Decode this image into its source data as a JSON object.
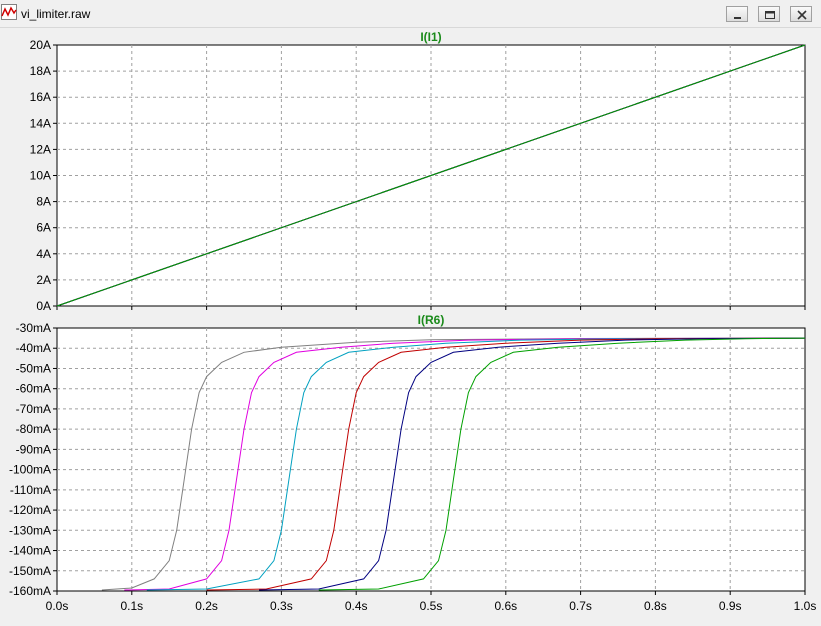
{
  "window": {
    "title": "vi_limiter.raw",
    "icon": "waveform-icon",
    "buttons": [
      "minimize-icon",
      "restore-icon",
      "close-icon"
    ]
  },
  "colors": {
    "grid": "#a0a0a0",
    "trace_names": "#1a8a1a",
    "series": [
      "#808080",
      "#e000e0",
      "#00a0c0",
      "#c00000",
      "#000080",
      "#00a000"
    ]
  },
  "chart_data": [
    {
      "type": "line",
      "title": "I(I1)",
      "xlabel": "",
      "ylabel": "",
      "xlim": [
        0,
        1.0
      ],
      "ylim": [
        0,
        20
      ],
      "x_ticks": [
        "0.0s",
        "0.1s",
        "0.2s",
        "0.3s",
        "0.4s",
        "0.5s",
        "0.6s",
        "0.7s",
        "0.8s",
        "0.9s",
        "1.0s"
      ],
      "y_ticks": [
        "0A",
        "2A",
        "4A",
        "6A",
        "8A",
        "10A",
        "12A",
        "14A",
        "16A",
        "18A",
        "20A"
      ],
      "grid": true,
      "series": [
        {
          "color": "#808080",
          "x": [
            0,
            1.0
          ],
          "y": [
            0,
            20
          ]
        },
        {
          "color": "#e000e0",
          "x": [
            0,
            1.0
          ],
          "y": [
            0,
            20
          ]
        },
        {
          "color": "#00a0c0",
          "x": [
            0,
            1.0
          ],
          "y": [
            0,
            20
          ]
        },
        {
          "color": "#c00000",
          "x": [
            0,
            1.0
          ],
          "y": [
            0,
            20
          ]
        },
        {
          "color": "#000080",
          "x": [
            0,
            1.0
          ],
          "y": [
            0,
            20
          ]
        },
        {
          "color": "#00a000",
          "x": [
            0,
            1.0
          ],
          "y": [
            0,
            20
          ]
        }
      ]
    },
    {
      "type": "line",
      "title": "I(R6)",
      "xlabel": "",
      "ylabel": "",
      "xlim": [
        0,
        1.0
      ],
      "ylim": [
        -160,
        -30
      ],
      "x_ticks": [
        "0.0s",
        "0.1s",
        "0.2s",
        "0.3s",
        "0.4s",
        "0.5s",
        "0.6s",
        "0.7s",
        "0.8s",
        "0.9s",
        "1.0s"
      ],
      "y_ticks": [
        "-30mA",
        "-40mA",
        "-50mA",
        "-60mA",
        "-70mA",
        "-80mA",
        "-90mA",
        "-100mA",
        "-110mA",
        "-120mA",
        "-130mA",
        "-140mA",
        "-150mA",
        "-160mA"
      ],
      "grid": true,
      "series": [
        {
          "color": "#808080",
          "x": [
            0.06,
            0.1,
            0.13,
            0.15,
            0.16,
            0.17,
            0.18,
            0.19,
            0.2,
            0.22,
            0.25,
            0.3,
            0.4,
            0.5,
            0.7,
            1.0
          ],
          "y": [
            -159.5,
            -158.5,
            -154,
            -145,
            -130,
            -105,
            -80,
            -62,
            -54,
            -47,
            -42,
            -39.5,
            -37,
            -35.8,
            -35.2,
            -35
          ]
        },
        {
          "color": "#e000e0",
          "x": [
            0.09,
            0.15,
            0.2,
            0.22,
            0.23,
            0.24,
            0.25,
            0.26,
            0.27,
            0.29,
            0.32,
            0.38,
            0.45,
            0.55,
            0.7,
            1.0
          ],
          "y": [
            -159.5,
            -159,
            -154,
            -145,
            -130,
            -105,
            -80,
            -62,
            -54,
            -47,
            -42,
            -39.5,
            -37.5,
            -36,
            -35.3,
            -35
          ]
        },
        {
          "color": "#00a0c0",
          "x": [
            0.12,
            0.2,
            0.27,
            0.29,
            0.3,
            0.31,
            0.32,
            0.33,
            0.34,
            0.36,
            0.39,
            0.45,
            0.52,
            0.62,
            0.75,
            1.0
          ],
          "y": [
            -159.5,
            -159,
            -154,
            -145,
            -130,
            -105,
            -80,
            -62,
            -54,
            -47,
            -42,
            -39.5,
            -37.5,
            -36,
            -35.3,
            -35
          ]
        },
        {
          "color": "#c00000",
          "x": [
            0.2,
            0.28,
            0.34,
            0.36,
            0.37,
            0.38,
            0.39,
            0.4,
            0.41,
            0.43,
            0.46,
            0.52,
            0.6,
            0.7,
            0.8,
            1.0
          ],
          "y": [
            -159.5,
            -159,
            -154,
            -145,
            -130,
            -105,
            -80,
            -62,
            -54,
            -47,
            -42,
            -39.5,
            -37.5,
            -36,
            -35.3,
            -35
          ]
        },
        {
          "color": "#000080",
          "x": [
            0.27,
            0.35,
            0.41,
            0.43,
            0.44,
            0.45,
            0.46,
            0.47,
            0.48,
            0.5,
            0.53,
            0.59,
            0.67,
            0.76,
            0.86,
            1.0
          ],
          "y": [
            -159.5,
            -159,
            -154,
            -145,
            -130,
            -105,
            -80,
            -62,
            -54,
            -47,
            -42,
            -39.5,
            -37.5,
            -36,
            -35.3,
            -35
          ]
        },
        {
          "color": "#00a000",
          "x": [
            0.35,
            0.43,
            0.49,
            0.51,
            0.52,
            0.53,
            0.54,
            0.55,
            0.56,
            0.58,
            0.61,
            0.67,
            0.75,
            0.84,
            0.92,
            1.0
          ],
          "y": [
            -159.5,
            -159,
            -154,
            -145,
            -130,
            -105,
            -80,
            -62,
            -54,
            -47,
            -42,
            -39.5,
            -37.5,
            -36,
            -35.3,
            -35
          ]
        }
      ]
    }
  ]
}
